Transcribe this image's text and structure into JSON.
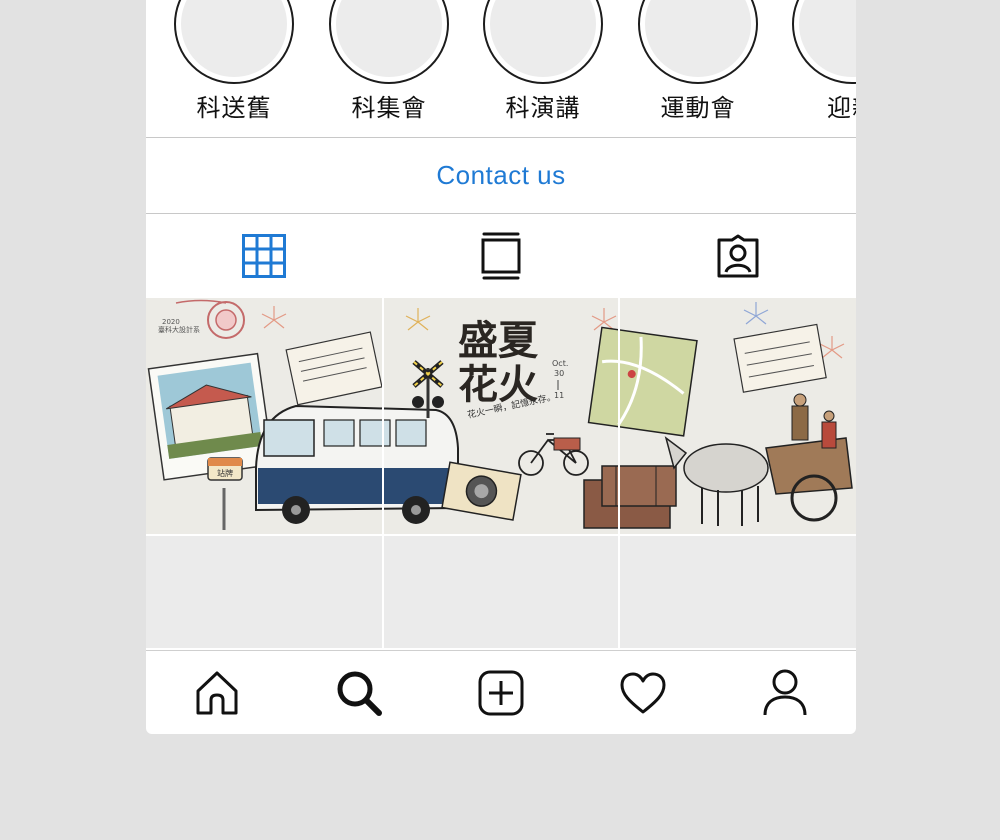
{
  "highlights": [
    {
      "label": "科送舊"
    },
    {
      "label": "科集會"
    },
    {
      "label": "科演講"
    },
    {
      "label": "運動會"
    },
    {
      "label": "迎新"
    }
  ],
  "contact": {
    "label": "Contact us"
  },
  "tabs": [
    {
      "icon": "grid-icon",
      "active": true
    },
    {
      "icon": "igtv-icon",
      "active": false
    },
    {
      "icon": "tagged-icon",
      "active": false
    }
  ],
  "banner": {
    "title_line1": "盛夏",
    "title_line2": "花火",
    "date_top": "Oct.",
    "date_mid": "30",
    "date_bottom": "11",
    "tagline": "花火一瞬，記憶永存。",
    "stamp": "2020",
    "stamp_sub": "臺科大設計系",
    "sign_text": "站牌"
  },
  "bottom_nav": [
    {
      "icon": "home-icon"
    },
    {
      "icon": "search-icon"
    },
    {
      "icon": "new-post-icon"
    },
    {
      "icon": "activity-heart-icon"
    },
    {
      "icon": "profile-icon"
    }
  ],
  "colors": {
    "accent": "#1f7ad4",
    "icon": "#111111",
    "placeholder": "#ebebeb"
  }
}
